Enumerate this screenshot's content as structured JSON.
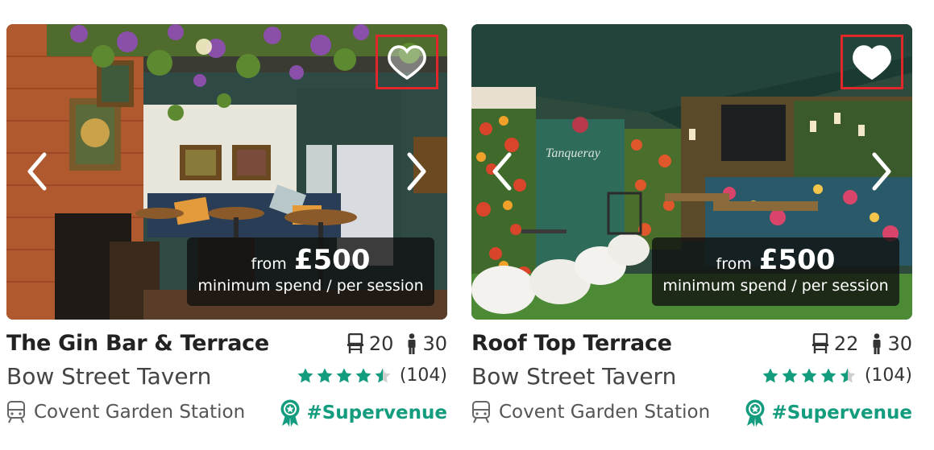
{
  "cards": [
    {
      "price_from": "from",
      "price_amount": "£500",
      "price_sub": "minimum spend / per session",
      "title": "The Gin Bar & Terrace",
      "seated": "20",
      "standing": "30",
      "venue": "Bow Street Tavern",
      "rating_stars": 4.5,
      "review_count": "(104)",
      "station": "Covent Garden Station",
      "badge": "#Supervenue",
      "favourited": false
    },
    {
      "price_from": "from",
      "price_amount": "£500",
      "price_sub": "minimum spend / per session",
      "title": "Roof Top Terrace",
      "seated": "22",
      "standing": "30",
      "venue": "Bow Street Tavern",
      "rating_stars": 4.5,
      "review_count": "(104)",
      "station": "Covent Garden Station",
      "badge": "#Supervenue",
      "favourited": false
    }
  ],
  "colors": {
    "accent": "#149c7e",
    "highlight_box": "#e0282b",
    "star": "#149c7e"
  },
  "icons": {
    "favourite": "heart-icon",
    "prev": "chevron-left-icon",
    "next": "chevron-right-icon",
    "seated": "chair-icon",
    "standing": "person-icon",
    "station": "train-icon",
    "badge": "award-ribbon-icon"
  }
}
